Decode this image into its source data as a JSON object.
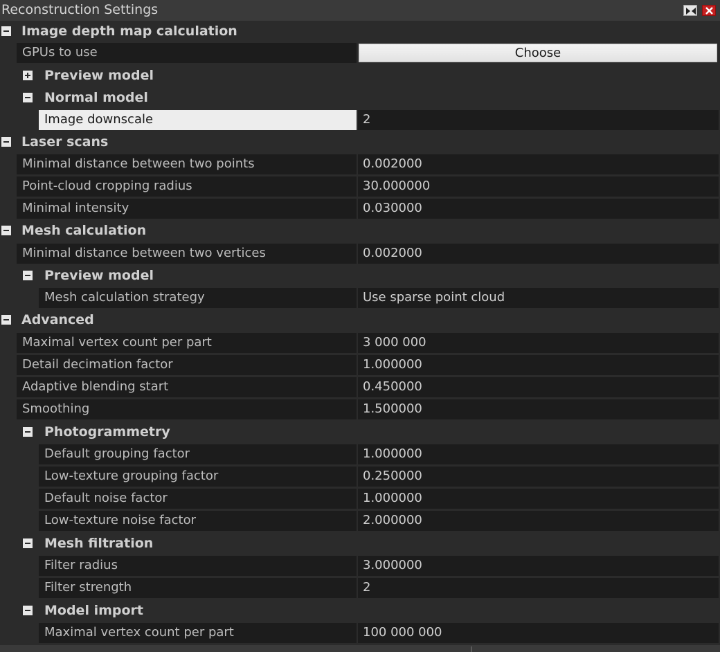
{
  "window": {
    "title": "Reconstruction Settings",
    "pin_icon": "pin-icon",
    "close_icon": "close-icon",
    "accent_close": "#c62020"
  },
  "sections": {
    "depth": {
      "label": "Image depth map calculation",
      "gpus": {
        "name": "GPUs to use",
        "button": "Choose"
      },
      "preview": {
        "label": "Preview model"
      },
      "normal": {
        "label": "Normal model",
        "downscale": {
          "name": "Image downscale",
          "value": "2"
        }
      }
    },
    "laser": {
      "label": "Laser scans",
      "rows": [
        {
          "name": "Minimal distance between two points",
          "value": "0.002000"
        },
        {
          "name": "Point-cloud cropping radius",
          "value": "30.000000"
        },
        {
          "name": "Minimal intensity",
          "value": "0.030000"
        }
      ]
    },
    "mesh": {
      "label": "Mesh calculation",
      "min_dist": {
        "name": "Minimal distance between two vertices",
        "value": "0.002000"
      },
      "preview": {
        "label": "Preview model",
        "strategy": {
          "name": "Mesh calculation strategy",
          "value": "Use sparse point cloud"
        }
      }
    },
    "advanced": {
      "label": "Advanced",
      "rows": [
        {
          "name": "Maximal vertex count per part",
          "value": "3 000 000"
        },
        {
          "name": "Detail decimation factor",
          "value": "1.000000"
        },
        {
          "name": "Adaptive blending start",
          "value": "0.450000"
        },
        {
          "name": "Smoothing",
          "value": "1.500000"
        }
      ],
      "photogrammetry": {
        "label": "Photogrammetry",
        "rows": [
          {
            "name": "Default grouping factor",
            "value": "1.000000"
          },
          {
            "name": "Low-texture grouping factor",
            "value": "0.250000"
          },
          {
            "name": "Default noise factor",
            "value": "1.000000"
          },
          {
            "name": "Low-texture noise factor",
            "value": "2.000000"
          }
        ]
      },
      "filtration": {
        "label": "Mesh filtration",
        "rows": [
          {
            "name": "Filter radius",
            "value": "3.000000"
          },
          {
            "name": "Filter strength",
            "value": "2"
          }
        ]
      },
      "import": {
        "label": "Model import",
        "rows": [
          {
            "name": "Maximal vertex count per part",
            "value": "100 000 000"
          }
        ]
      }
    }
  }
}
